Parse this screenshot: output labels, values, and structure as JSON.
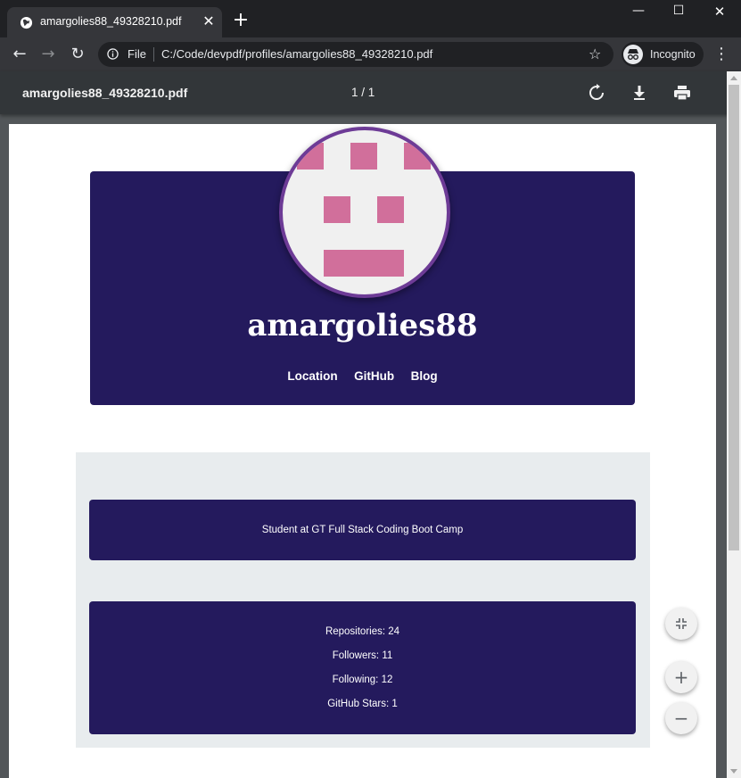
{
  "browser": {
    "tab_title": "amargolies88_49328210.pdf",
    "tab_close": "✕",
    "new_tab": "+",
    "window_controls": {
      "minimize": "—",
      "maximize": "☐",
      "close": "✕"
    },
    "nav": {
      "back": "←",
      "forward": "→",
      "reload": "↻"
    },
    "protocol_label": "File",
    "url": "C:/Code/devpdf/profiles/amargolies88_49328210.pdf",
    "bookmark_star": "☆",
    "incognito_label": "Incognito",
    "menu": "⋮"
  },
  "pdf_viewer": {
    "filename": "amargolies88_49328210.pdf",
    "page_indicator": "1 / 1",
    "icons": [
      "rotate-icon",
      "download-icon",
      "print-icon"
    ]
  },
  "profile": {
    "username": "amargolies88",
    "links": [
      "Location",
      "GitHub",
      "Blog"
    ],
    "bio": "Student at GT Full Stack Coding Boot Camp",
    "stats": {
      "repositories": "Repositories: 24",
      "followers": "Followers: 11",
      "following": "Following: 12",
      "stars": "GitHub Stars: 1"
    }
  },
  "zoom_controls": {
    "fit": "⤡",
    "zoom_in": "+",
    "zoom_out": "−"
  },
  "colors": {
    "card": "#241a5d",
    "avatar_border": "#6d3b96",
    "avatar_pixel": "#d16f9b",
    "content_bg": "#e8ecee"
  }
}
